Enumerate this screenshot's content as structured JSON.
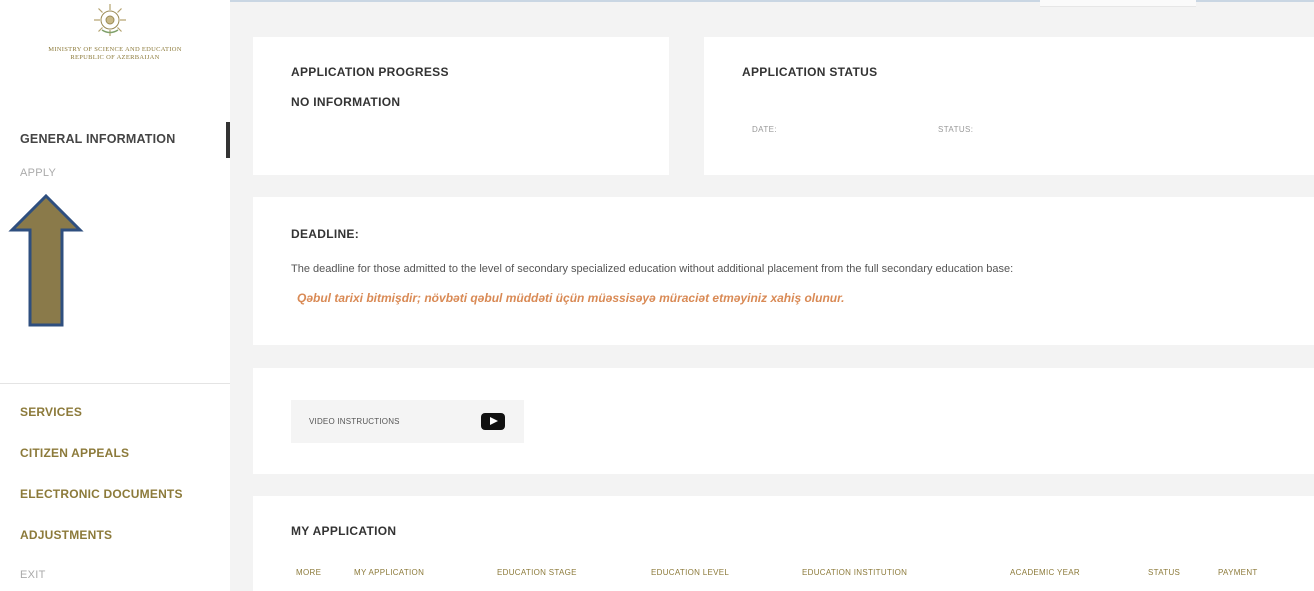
{
  "sidebar": {
    "ministry_line1": "Ministry of Science and Education",
    "ministry_line2": "Republic of Azerbaijan",
    "general_information": "GENERAL INFORMATION",
    "apply": "APPLY",
    "services": "SERVICES",
    "citizen_appeals": "CITIZEN APPEALS",
    "electronic_documents": "ELECTRONIC DOCUMENTS",
    "adjustments": "ADJUSTMENTS",
    "exit": "EXIT"
  },
  "progress": {
    "title": "APPLICATION PROGRESS",
    "value": "NO INFORMATION"
  },
  "status_card": {
    "title": "APPLICATION STATUS",
    "date_label": "DATE:",
    "status_label": "STATUS:"
  },
  "deadline": {
    "title": "DEADLINE:",
    "text": "The deadline for those admitted to the level of secondary specialized education without additional placement from the full secondary education base:",
    "warning": "Qəbul tarixi bitmişdir; növbəti qəbul müddəti üçün müəssisəyə müraciət etməyiniz xahiş olunur."
  },
  "video": {
    "label": "VIDEO INSTRUCTIONS"
  },
  "my_application": {
    "title": "MY APPLICATION",
    "columns": [
      "MORE",
      "MY APPLICATION",
      "EDUCATION STAGE",
      "EDUCATION LEVEL",
      "EDUCATION INSTITUTION",
      "ACADEMIC YEAR",
      "STATUS",
      "PAYMENT"
    ]
  },
  "icons": {
    "emblem": "azerbaijan-emblem-icon",
    "video": "youtube-play-icon",
    "annotation": "up-arrow-icon"
  },
  "colors": {
    "brand_gold": "#8c7a3a",
    "warning": "#d98a55",
    "arrow_fill": "#8a7a4a",
    "arrow_stroke": "#2f4f7f"
  }
}
